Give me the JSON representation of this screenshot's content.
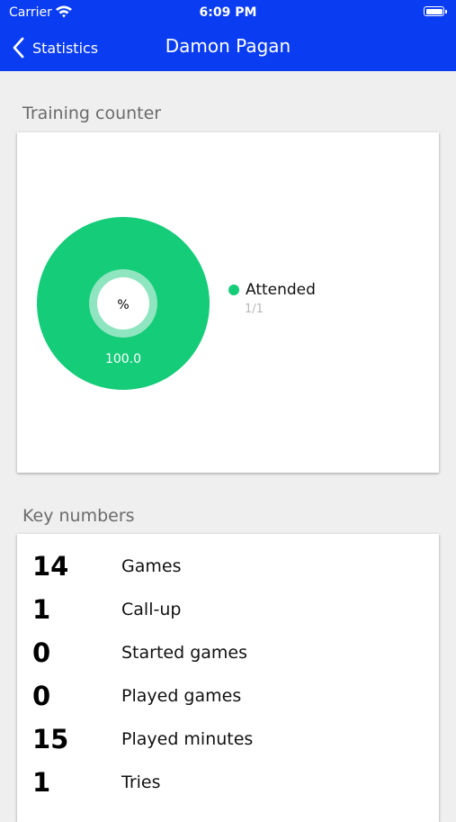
{
  "status_bar": {
    "carrier": "Carrier",
    "time": "6:09 PM"
  },
  "nav": {
    "back_label": "Statistics",
    "title": "Damon Pagan"
  },
  "colors": {
    "nav_bg": "#0a3cf2",
    "attended": "#15cc79"
  },
  "training": {
    "section_title": "Training counter",
    "center_label": "%",
    "value_label": "100.0",
    "legend": [
      {
        "name": "Attended",
        "count": "1/1",
        "fraction": 1.0
      }
    ]
  },
  "key_numbers": {
    "section_title": "Key numbers",
    "items": [
      {
        "value": "14",
        "label": "Games"
      },
      {
        "value": "1",
        "label": "Call-up"
      },
      {
        "value": "0",
        "label": "Started games"
      },
      {
        "value": "0",
        "label": "Played games"
      },
      {
        "value": "15",
        "label": "Played minutes"
      },
      {
        "value": "1",
        "label": "Tries"
      }
    ]
  }
}
